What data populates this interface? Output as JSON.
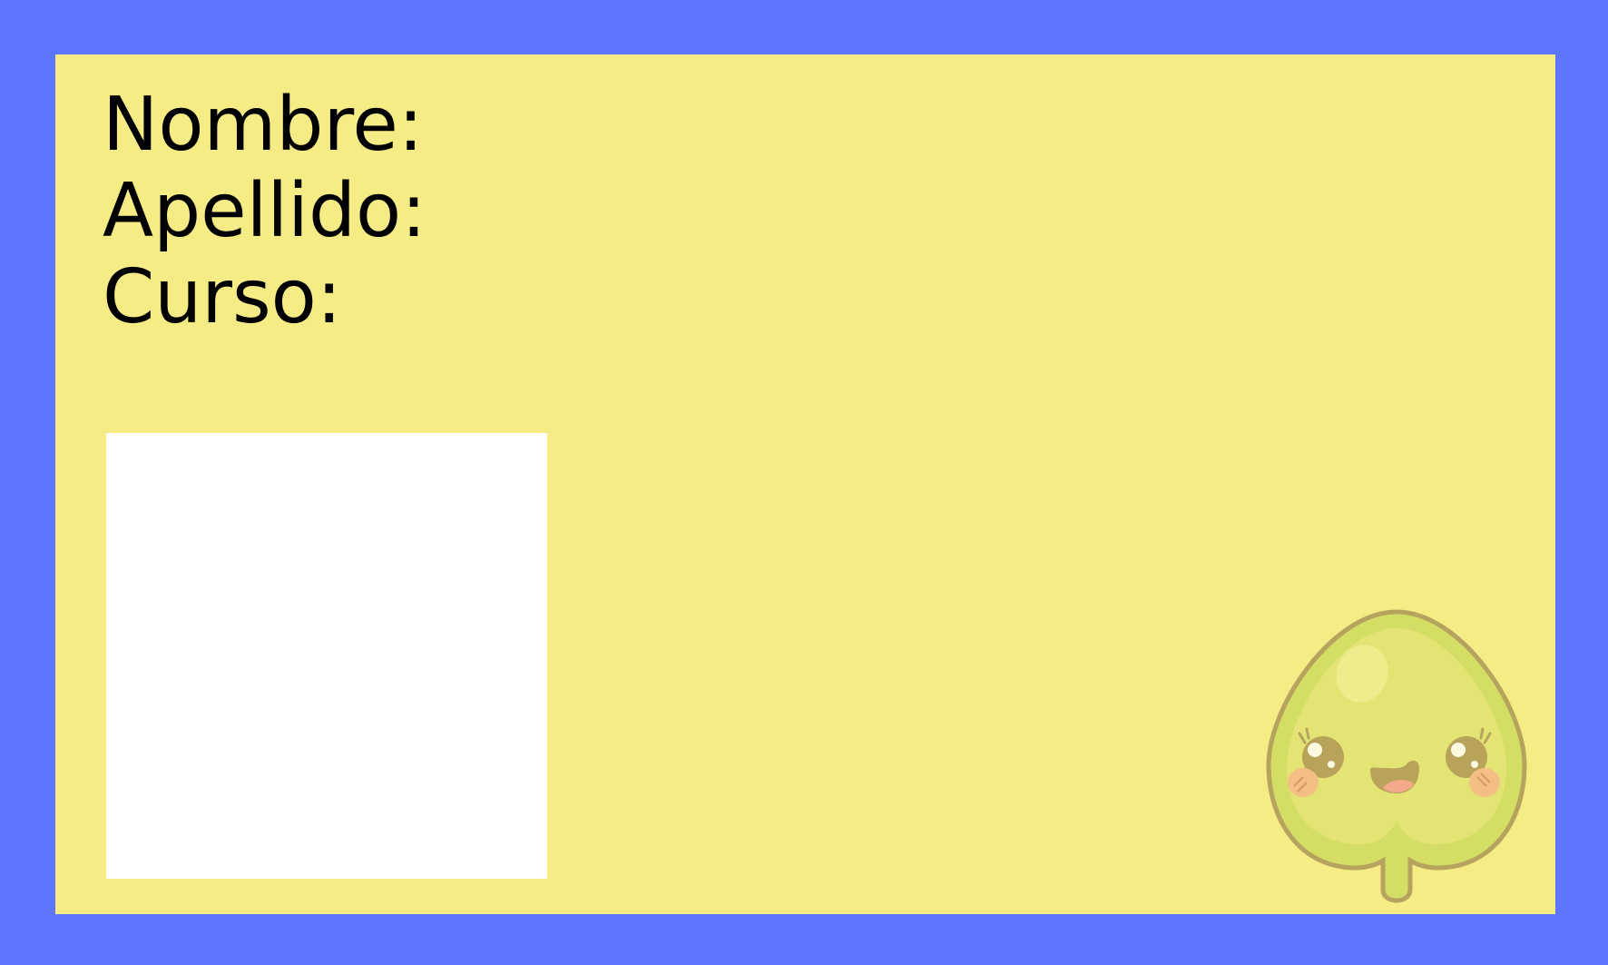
{
  "card": {
    "labels": {
      "name": "Nombre:",
      "surname": "Apellido:",
      "course": "Curso:"
    }
  },
  "colors": {
    "frame": "#5e76ff",
    "card": "#f6ec86",
    "photo_box": "#ffffff",
    "mascot_body": "#d4de64",
    "mascot_outline": "#b5a35e"
  },
  "icons": {
    "mascot": "kawaii-seed-mascot-icon"
  }
}
